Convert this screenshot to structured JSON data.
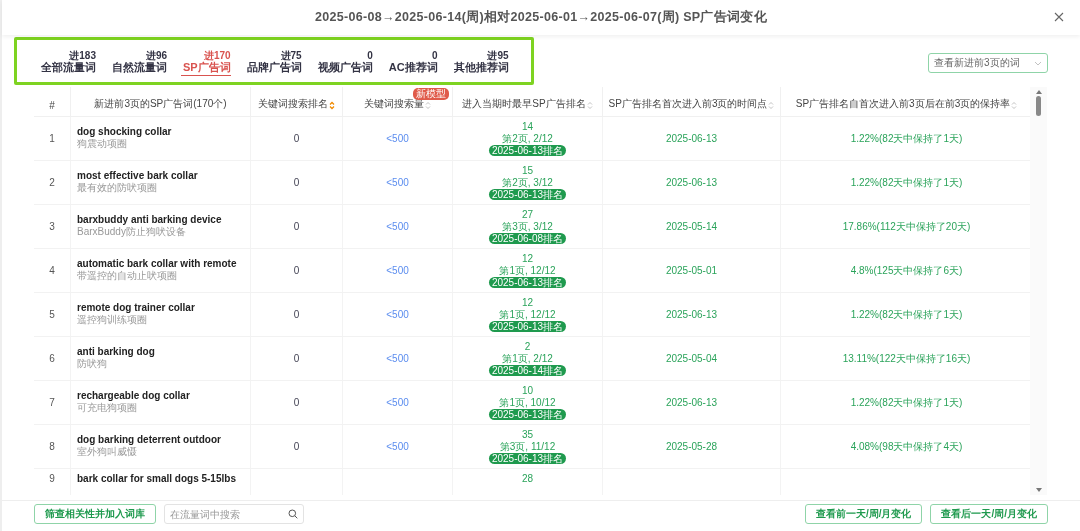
{
  "window": {
    "title": "2025-06-08→2025-06-14(周)相对2025-06-01→2025-06-07(周) SP广告词变化"
  },
  "tabs": [
    {
      "label": "全部流量词",
      "count": "进183",
      "selected": false
    },
    {
      "label": "自然流量词",
      "count": "进96",
      "selected": false
    },
    {
      "label": "SP广告词",
      "count": "进170",
      "selected": true
    },
    {
      "label": "品牌广告词",
      "count": "进75",
      "selected": false
    },
    {
      "label": "视频广告词",
      "count": "0",
      "selected": false
    },
    {
      "label": "AC推荐词",
      "count": "0",
      "selected": false
    },
    {
      "label": "其他推荐词",
      "count": "进95",
      "selected": false
    }
  ],
  "filter_select": {
    "value": "查看新进前3页的词"
  },
  "table": {
    "columns": [
      {
        "label": "#",
        "sortable": false
      },
      {
        "label": "新进前3页的SP广告词(170个)",
        "sortable": false
      },
      {
        "label": "关键词搜索排名",
        "sortable": true,
        "sort_active": true
      },
      {
        "label": "关键词搜索量",
        "sortable": true,
        "sort_active": false,
        "badge": "新模型"
      },
      {
        "label": "进入当期时最早SP广告排名",
        "sortable": true,
        "sort_active": false
      },
      {
        "label": "SP广告排名首次进入前3页的时间点",
        "sortable": true,
        "sort_active": false
      },
      {
        "label": "SP广告排名自首次进入前3页后在前3页的保持率",
        "sortable": true,
        "sort_active": false
      }
    ],
    "rows": [
      {
        "index": "1",
        "keyword": "dog shocking collar",
        "translation": "狗震动项圈",
        "search_rank": "0",
        "search_volume": "<500",
        "rank": "14",
        "page": "第2页, 2/12",
        "rank_date": "2025-06-13排名",
        "first_date": "2025-06-13",
        "retention": "1.22%(82天中保持了1天)"
      },
      {
        "index": "2",
        "keyword": "most effective bark collar",
        "translation": "最有效的防吠项圈",
        "search_rank": "0",
        "search_volume": "<500",
        "rank": "15",
        "page": "第2页, 3/12",
        "rank_date": "2025-06-13排名",
        "first_date": "2025-06-13",
        "retention": "1.22%(82天中保持了1天)"
      },
      {
        "index": "3",
        "keyword": "barxbuddy anti barking device",
        "translation": "BarxBuddy防止狗吠设备",
        "search_rank": "0",
        "search_volume": "<500",
        "rank": "27",
        "page": "第3页, 3/12",
        "rank_date": "2025-06-08排名",
        "first_date": "2025-05-14",
        "retention": "17.86%(112天中保持了20天)"
      },
      {
        "index": "4",
        "keyword": "automatic bark collar with remote",
        "translation": "带遥控的自动止吠项圈",
        "search_rank": "0",
        "search_volume": "<500",
        "rank": "12",
        "page": "第1页, 12/12",
        "rank_date": "2025-06-13排名",
        "first_date": "2025-05-01",
        "retention": "4.8%(125天中保持了6天)"
      },
      {
        "index": "5",
        "keyword": "remote dog trainer collar",
        "translation": "遥控狗训练项圈",
        "search_rank": "0",
        "search_volume": "<500",
        "rank": "12",
        "page": "第1页, 12/12",
        "rank_date": "2025-06-13排名",
        "first_date": "2025-06-13",
        "retention": "1.22%(82天中保持了1天)"
      },
      {
        "index": "6",
        "keyword": "anti barking dog",
        "translation": "防吠狗",
        "search_rank": "0",
        "search_volume": "<500",
        "rank": "2",
        "page": "第1页, 2/12",
        "rank_date": "2025-06-14排名",
        "first_date": "2025-05-04",
        "retention": "13.11%(122天中保持了16天)"
      },
      {
        "index": "7",
        "keyword": "rechargeable dog collar",
        "translation": "可充电狗项圈",
        "search_rank": "0",
        "search_volume": "<500",
        "rank": "10",
        "page": "第1页, 10/12",
        "rank_date": "2025-06-13排名",
        "first_date": "2025-06-13",
        "retention": "1.22%(82天中保持了1天)"
      },
      {
        "index": "8",
        "keyword": "dog barking deterrent outdoor",
        "translation": "室外狗叫威慑",
        "search_rank": "0",
        "search_volume": "<500",
        "rank": "35",
        "page": "第3页, 11/12",
        "rank_date": "2025-06-13排名",
        "first_date": "2025-05-28",
        "retention": "4.08%(98天中保持了4天)"
      },
      {
        "index": "9",
        "keyword": "bark collar for small dogs 5-15lbs",
        "rank": "28"
      }
    ]
  },
  "footer": {
    "filter_button": "筛查相关性并加入词库",
    "search": {
      "placeholder": "在流量词中搜索"
    },
    "prev_button": "查看前一天/周/月变化",
    "next_button": "查看后一天/周/月变化"
  }
}
